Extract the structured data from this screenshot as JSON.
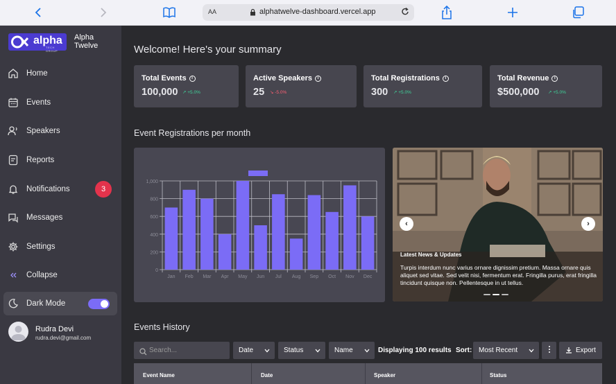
{
  "browser": {
    "aa_label": "AA",
    "url": "alphatwelve-dashboard.vercel.app"
  },
  "sidebar": {
    "brand_word": "alpha",
    "brand_sub": "TECH GROUP",
    "brand_name_line1": "Alpha",
    "brand_name_line2": "Twelve",
    "items": [
      {
        "label": "Home",
        "icon": "home-icon"
      },
      {
        "label": "Events",
        "icon": "calendar-icon"
      },
      {
        "label": "Speakers",
        "icon": "speakers-icon"
      },
      {
        "label": "Reports",
        "icon": "reports-icon"
      },
      {
        "label": "Notifications",
        "icon": "bell-icon",
        "badge": "3"
      },
      {
        "label": "Messages",
        "icon": "messages-icon"
      },
      {
        "label": "Settings",
        "icon": "gear-icon"
      },
      {
        "label": "Collapse",
        "icon": "collapse-icon"
      }
    ],
    "dark_mode_label": "Dark Mode",
    "dark_mode_on": true,
    "user": {
      "name": "Rudra Devi",
      "email": "rudra.devi@gmail.com"
    }
  },
  "main": {
    "welcome": "Welcome! Here's your summary",
    "stats": [
      {
        "title": "Total Events",
        "value": "100,000",
        "change": "+5.0%",
        "trend": "up"
      },
      {
        "title": "Active Speakers",
        "value": "25",
        "change": "-5.0%",
        "trend": "down"
      },
      {
        "title": "Total Registrations",
        "value": "300",
        "change": "+5.0%",
        "trend": "up"
      },
      {
        "title": "Total Revenue",
        "value": "$500,000",
        "change": "+5.0%",
        "trend": "up"
      }
    ],
    "chart_title": "Event Registrations per month",
    "carousel": {
      "title": "Latest News & Updates",
      "text": "Turpis interdum nunc varius ornare dignissim pretium. Massa ornare quis aliquet sed vitae. Sed velit nisi, fermentum erat. Fringilla purus, erat fringilla tincidunt quisque non. Pellentesque in ut tellus.",
      "prev": "‹",
      "next": "›"
    },
    "events_history_title": "Events History",
    "search_placeholder": "Search...",
    "filters": [
      "Date",
      "Status",
      "Name"
    ],
    "results_text": "Displaying 100 results",
    "sort_label": "Sort:",
    "sort_value": "Most Recent",
    "export_label": "Export",
    "table_headers": [
      "Event Name",
      "Date",
      "Speaker",
      "Status"
    ]
  },
  "colors": {
    "accent": "#7b6cf6",
    "up": "#3fd39a",
    "down": "#ff5f73",
    "badge": "#e3334c"
  },
  "chart_data": {
    "type": "bar",
    "categories": [
      "Jan",
      "Feb",
      "Mar",
      "Apr",
      "May",
      "Jun",
      "Jul",
      "Aug",
      "Sep",
      "Oct",
      "Nov",
      "Dec"
    ],
    "values": [
      700,
      900,
      800,
      400,
      1000,
      500,
      850,
      350,
      840,
      650,
      950,
      600
    ],
    "yticks": [
      "0",
      "200",
      "400",
      "600",
      "800",
      "1,000"
    ],
    "ylim": [
      0,
      1000
    ],
    "grid": true,
    "bar_color": "#7b6cf6"
  }
}
